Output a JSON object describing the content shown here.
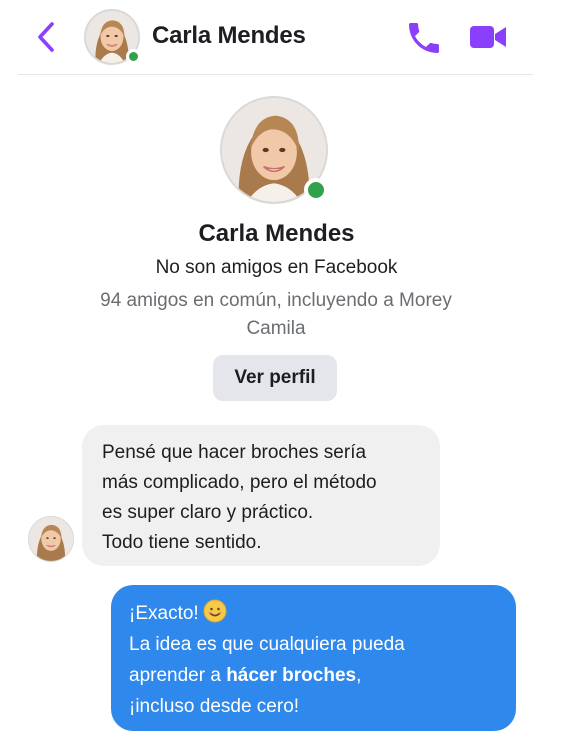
{
  "header": {
    "contact_name": "Carla Mendes",
    "back_icon": "chevron-left-icon",
    "call_icon": "phone-icon",
    "video_icon": "video-camera-icon",
    "accent_color": "#8a3ffc",
    "online_color": "#31a24c"
  },
  "profile": {
    "name": "Carla Mendes",
    "relationship": "No son amigos en Facebook",
    "mutual_line1": "94 amigos en común, incluyendo a Morey",
    "mutual_line2": "Camila",
    "button_label": "Ver perfil"
  },
  "messages": [
    {
      "direction": "incoming",
      "lines": [
        "Pensé que hacer broches sería",
        "más complicado, pero el método",
        "es super claro y práctico.",
        "Todo tiene sentido."
      ]
    },
    {
      "direction": "outgoing",
      "line1": "¡Exacto!",
      "emoji": "smiling-face-icon",
      "line2": "La idea es que cualquiera pueda",
      "line3_prefix": "aprender a ",
      "line3_bold": "hácer broches",
      "line3_suffix": ",",
      "line4": "¡incluso desde cero!",
      "bubble_color": "#2f88ec"
    }
  ]
}
